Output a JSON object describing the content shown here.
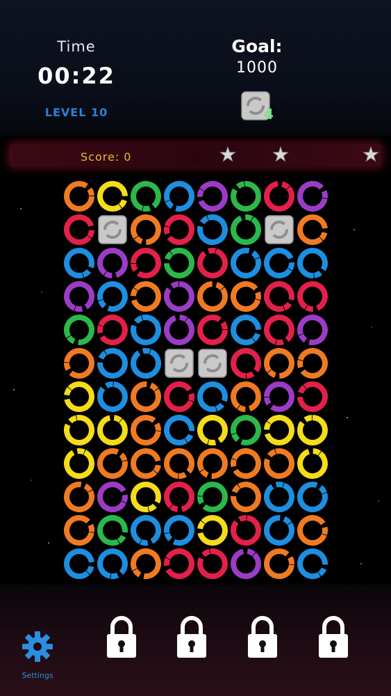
{
  "hud": {
    "time_label": "Time",
    "time_value": "00:22",
    "level": "LEVEL 10",
    "goal_label": "Goal:",
    "goal_value": "1000",
    "goal_tile_count": "4",
    "score_text": "Score:  0"
  },
  "stars_count": 3,
  "colors": {
    "o": "#f07a22",
    "y": "#f5dc1a",
    "g": "#2bb84a",
    "b": "#1e8ee0",
    "p": "#9b3cc6",
    "r": "#e3204a",
    "blocker": "#c9c9c9",
    "level_text": "#2f7fd8",
    "score_text": "#e2c02e",
    "goal_count": "#7ee37c",
    "settings": "#2a8fe0"
  },
  "board": {
    "columns": 8,
    "rows": [
      [
        "o",
        "y",
        "g",
        "b",
        "p",
        "g",
        "r",
        "p"
      ],
      [
        "r",
        "X",
        "o",
        "r",
        "b",
        "g",
        "X",
        "o"
      ],
      [
        "b",
        "p",
        "r",
        "g",
        "r",
        "b",
        "b",
        "b"
      ],
      [
        "p",
        "b",
        "o",
        "p",
        "o",
        "o",
        "r",
        "r"
      ],
      [
        "g",
        "r",
        "b",
        "p",
        "r",
        "b",
        "r",
        "p"
      ],
      [
        "o",
        "b",
        "b",
        "X",
        "X",
        "r",
        "o",
        "o"
      ],
      [
        "y",
        "b",
        "o",
        "r",
        "b",
        "o",
        "p",
        "r"
      ],
      [
        "y",
        "y",
        "o",
        "b",
        "y",
        "g",
        "y",
        "y"
      ],
      [
        "y",
        "o",
        "o",
        "o",
        "o",
        "o",
        "o",
        "y"
      ],
      [
        "o",
        "p",
        "y",
        "r",
        "g",
        "o",
        "b",
        "b"
      ],
      [
        "o",
        "g",
        "b",
        "b",
        "y",
        "r",
        "b",
        "o"
      ],
      [
        "b",
        "b",
        "o",
        "r",
        "r",
        "p",
        "o",
        "b"
      ]
    ]
  },
  "bottom": {
    "settings_label": "Settings",
    "locks": [
      "locked",
      "locked",
      "locked",
      "locked"
    ]
  }
}
